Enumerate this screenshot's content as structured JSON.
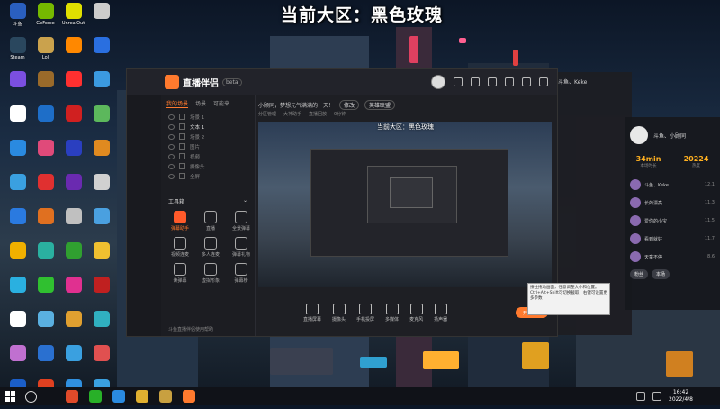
{
  "overlay_title": "当前大区：黑色玫瑰",
  "desktop_icons": [
    {
      "label": "斗鱼",
      "color": "#2a5fbf"
    },
    {
      "label": "GeForce",
      "color": "#76b900"
    },
    {
      "label": "UnrealOut",
      "color": "#e0e000"
    },
    {
      "label": "",
      "color": "#cccccc"
    },
    {
      "label": "Steam",
      "color": "#2a475e"
    },
    {
      "label": "Lol",
      "color": "#caa24d"
    },
    {
      "label": "",
      "color": "#ff8800"
    },
    {
      "label": "",
      "color": "#2a6fe0"
    },
    {
      "label": "",
      "color": "#7b4fe0"
    },
    {
      "label": "",
      "color": "#9a6a2a"
    },
    {
      "label": "",
      "color": "#ff3030"
    },
    {
      "label": "",
      "color": "#3b9ae0"
    },
    {
      "label": "",
      "color": "#ffffff"
    },
    {
      "label": "",
      "color": "#1e6ec8"
    },
    {
      "label": "",
      "color": "#d02020"
    },
    {
      "label": "",
      "color": "#5cb85c"
    },
    {
      "label": "",
      "color": "#2a8ae0"
    },
    {
      "label": "",
      "color": "#e04a7a"
    },
    {
      "label": "",
      "color": "#2a3fc0"
    },
    {
      "label": "",
      "color": "#e08a20"
    },
    {
      "label": "",
      "color": "#3aa0e0"
    },
    {
      "label": "",
      "color": "#e03030"
    },
    {
      "label": "",
      "color": "#6a2ab0"
    },
    {
      "label": "",
      "color": "#d0d0d0"
    },
    {
      "label": "",
      "color": "#2a7ae0"
    },
    {
      "label": "",
      "color": "#e07020"
    },
    {
      "label": "",
      "color": "#c0c0c0"
    },
    {
      "label": "",
      "color": "#4aa0e0"
    },
    {
      "label": "",
      "color": "#f0b000"
    },
    {
      "label": "",
      "color": "#2ab0a0"
    },
    {
      "label": "",
      "color": "#30a030"
    },
    {
      "label": "",
      "color": "#f0c030"
    },
    {
      "label": "",
      "color": "#2ab0e0"
    },
    {
      "label": "",
      "color": "#30c030"
    },
    {
      "label": "",
      "color": "#e03090"
    },
    {
      "label": "",
      "color": "#c02020"
    },
    {
      "label": "",
      "color": "#ffffff"
    },
    {
      "label": "",
      "color": "#5ab0e0"
    },
    {
      "label": "",
      "color": "#e0a030"
    },
    {
      "label": "",
      "color": "#30b0c0"
    },
    {
      "label": "",
      "color": "#c070d0"
    },
    {
      "label": "",
      "color": "#2a70d0"
    },
    {
      "label": "",
      "color": "#3aa0e0"
    },
    {
      "label": "",
      "color": "#e05050"
    },
    {
      "label": "",
      "color": "#1b5ec8"
    },
    {
      "label": "",
      "color": "#e04020"
    },
    {
      "label": "",
      "color": "#3090e0"
    },
    {
      "label": "",
      "color": "#3aa0e0"
    }
  ],
  "app": {
    "name": "直播伴侣",
    "beta": "beta",
    "panel_tabs": [
      "我的场景",
      "场景",
      "可能来"
    ],
    "scenes": [
      "场景 1",
      "文本 1",
      "场景 2",
      "图片",
      "视频",
      "摄像头",
      "全屏"
    ],
    "tool_header": "工具箱",
    "tools": [
      {
        "label": "弹幕助手",
        "hot": true
      },
      {
        "label": "直播",
        "hot": false
      },
      {
        "label": "全景弹幕",
        "hot": false
      },
      {
        "label": "视频连麦",
        "hot": false
      },
      {
        "label": "多人连麦",
        "hot": false
      },
      {
        "label": "弹幕礼物",
        "hot": false
      },
      {
        "label": "读弹幕",
        "hot": false
      },
      {
        "label": "虚拟形象",
        "hot": false
      },
      {
        "label": "弹幕榜",
        "hot": false
      }
    ],
    "panel_tip": "斗鱼直播伴侣使用帮助",
    "room_title": "小顾同，梦想元气满满的一天！",
    "edit_pill": "修改",
    "category_pill": "英雄联盟",
    "sub_info": [
      "分区管理",
      "大神助手",
      "直播回放",
      "0分钟"
    ],
    "preview_title": "当前大区：黑色玫瑰",
    "bottom_buttons": [
      "直播屏幕",
      "摄像头",
      "手机投屏",
      "多媒体",
      "麦克风",
      "扬声器"
    ],
    "start_button": "开始直播",
    "tooltip": "按住拖动画面，任意调整大小和位置。Ctrl+Alt+Shift可切换截取，右键可设置更多参数"
  },
  "right_panel": {
    "name": "斗鱼、小顾同",
    "stats": [
      {
        "value": "34min",
        "label": "本场时长"
      },
      {
        "value": "20224",
        "label": "热度"
      }
    ],
    "rows": [
      {
        "text": "斗鱼、Keke",
        "num": "12.1"
      },
      {
        "text": "长的漂亮",
        "num": "11.3"
      },
      {
        "text": "爱你的小宝",
        "num": "11.5"
      },
      {
        "text": "看到就好",
        "num": "11.7"
      },
      {
        "text": "天童不停",
        "num": "8.6"
      }
    ],
    "buttons": [
      "粉丝",
      "本场"
    ]
  },
  "behind_window": {
    "title": "斗鱼、Keke"
  },
  "taskbar": {
    "apps": [
      {
        "name": "chrome",
        "color": "#e04a2a"
      },
      {
        "name": "wechat",
        "color": "#28b028"
      },
      {
        "name": "messenger",
        "color": "#2a8ae0"
      },
      {
        "name": "explorer",
        "color": "#e0b030"
      },
      {
        "name": "league",
        "color": "#c8a040"
      },
      {
        "name": "douyu",
        "color": "#ff7a2e"
      }
    ],
    "time": "16:42",
    "date": "2022/4/8"
  }
}
